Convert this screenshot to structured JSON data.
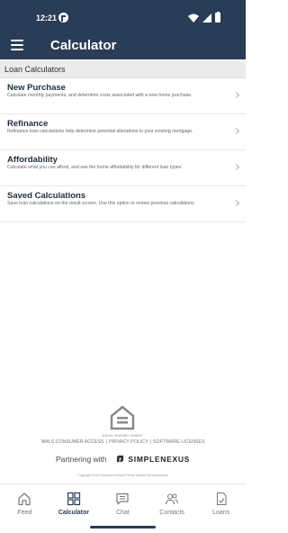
{
  "status_bar": {
    "time": "12:21"
  },
  "header": {
    "title": "Calculator"
  },
  "section": {
    "title": "Loan Calculators"
  },
  "calculators": [
    {
      "title": "New Purchase",
      "description": "Calculate monthly payments, and determine costs associated with a new home purchase."
    },
    {
      "title": "Refinance",
      "description": "Refinance loan calculations help determine potential alterations to your existing mortgage."
    },
    {
      "title": "Affordability",
      "description": "Calculate what you can afford, and see the home affordability for different loan types."
    },
    {
      "title": "Saved Calculations",
      "description": "Save loan calculations on the result screen. Use this option to review previous calculations."
    }
  ],
  "footer": {
    "ehl_text": "EQUAL HOUSING LENDER",
    "links": [
      "NMLS CONSUMER ACCESS",
      "PRIVACY POLICY",
      "SOFTWARE LICENSES"
    ],
    "link_separator": "|",
    "partner_prefix": "Partnering with",
    "partner_brand": "SIMPLENEXUS",
    "copyright": "Copyright 2022 American Armed Forces Mutual Aid Association"
  },
  "tabs": [
    {
      "label": "Feed",
      "icon": "home-icon",
      "active": false
    },
    {
      "label": "Calculator",
      "icon": "calculator-icon",
      "active": true
    },
    {
      "label": "Chat",
      "icon": "chat-icon",
      "active": false
    },
    {
      "label": "Contacts",
      "icon": "contacts-icon",
      "active": false
    },
    {
      "label": "Loans",
      "icon": "loans-document-icon",
      "active": false
    }
  ],
  "colors": {
    "primary": "#2a3d57",
    "section_bg": "#ebebeb",
    "background": "#ffffff"
  }
}
